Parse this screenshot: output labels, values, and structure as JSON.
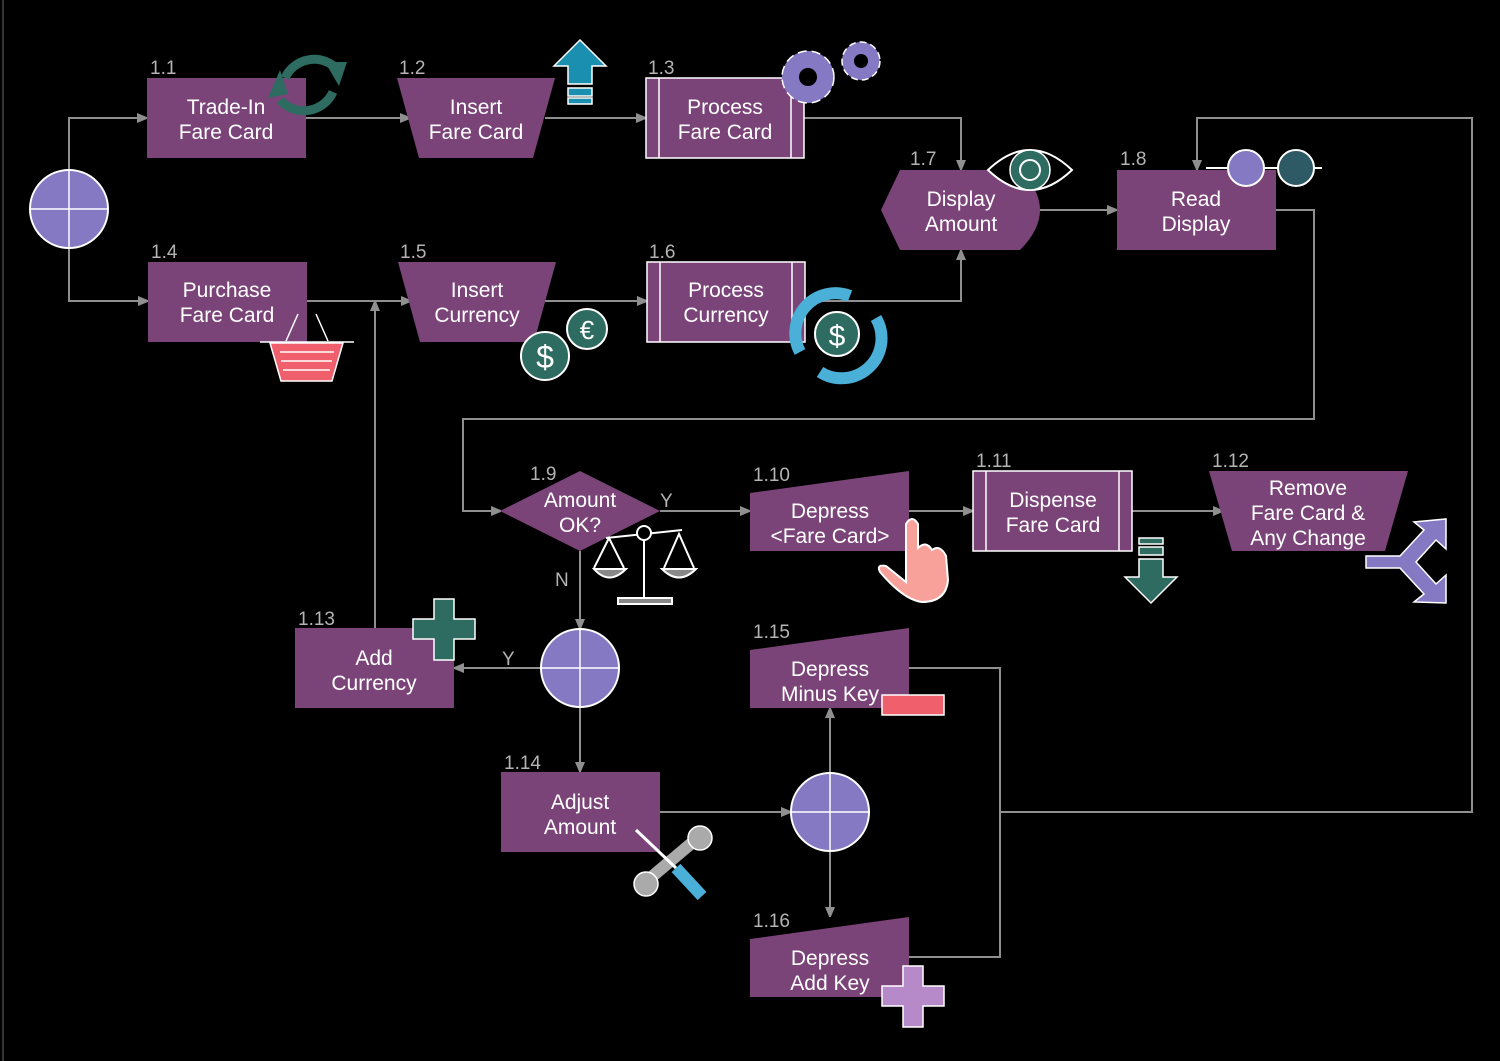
{
  "colors": {
    "process": "#7b4479",
    "connector": "#8f8f8f",
    "junction": "#8479c2",
    "background": "#000000",
    "icon_green": "#2e6b60",
    "icon_blue": "#4ab0d8",
    "icon_red": "#f0606c"
  },
  "nodes": {
    "n1_1": {
      "id": "1.1",
      "line1": "Trade-In",
      "line2": "Fare Card",
      "icon": "refresh-icon"
    },
    "n1_2": {
      "id": "1.2",
      "line1": "Insert",
      "line2": "Fare Card",
      "icon": "upload-arrow-icon"
    },
    "n1_3": {
      "id": "1.3",
      "line1": "Process",
      "line2": "Fare Card",
      "icon": "gears-icon"
    },
    "n1_4": {
      "id": "1.4",
      "line1": "Purchase",
      "line2": "Fare Card",
      "icon": "basket-icon"
    },
    "n1_5": {
      "id": "1.5",
      "line1": "Insert",
      "line2": "Currency",
      "icon": "dollar-euro-coins-icon"
    },
    "n1_6": {
      "id": "1.6",
      "line1": "Process",
      "line2": "Currency",
      "icon": "currency-exchange-icon"
    },
    "n1_7": {
      "id": "1.7",
      "line1": "Display",
      "line2": "Amount",
      "icon": "eye-icon"
    },
    "n1_8": {
      "id": "1.8",
      "line1": "Read",
      "line2": "Display",
      "icon": "glasses-icon"
    },
    "n1_9": {
      "id": "1.9",
      "line1": "Amount",
      "line2": "OK?",
      "icon": "scales-icon"
    },
    "n1_10": {
      "id": "1.10",
      "line1": "Depress",
      "line2": "<Fare Card>",
      "icon": "hand-pointer-icon"
    },
    "n1_11": {
      "id": "1.11",
      "line1": "Dispense",
      "line2": "Fare Card",
      "icon": "download-arrow-icon"
    },
    "n1_12": {
      "id": "1.12",
      "line1": "Remove",
      "line2": "Fare Card &",
      "line3": "Any Change",
      "icon": "split-arrow-icon"
    },
    "n1_13": {
      "id": "1.13",
      "line1": "Add",
      "line2": "Currency",
      "icon": "plus-icon"
    },
    "n1_14": {
      "id": "1.14",
      "line1": "Adjust",
      "line2": "Amount",
      "icon": "tools-icon"
    },
    "n1_15": {
      "id": "1.15",
      "line1": "Depress",
      "line2": "Minus Key",
      "icon": "minus-icon"
    },
    "n1_16": {
      "id": "1.16",
      "line1": "Depress",
      "line2": "Add Key",
      "icon": "plus-icon"
    }
  },
  "edge_labels": {
    "yes1": "Y",
    "no1": "N",
    "yes2": "Y"
  }
}
